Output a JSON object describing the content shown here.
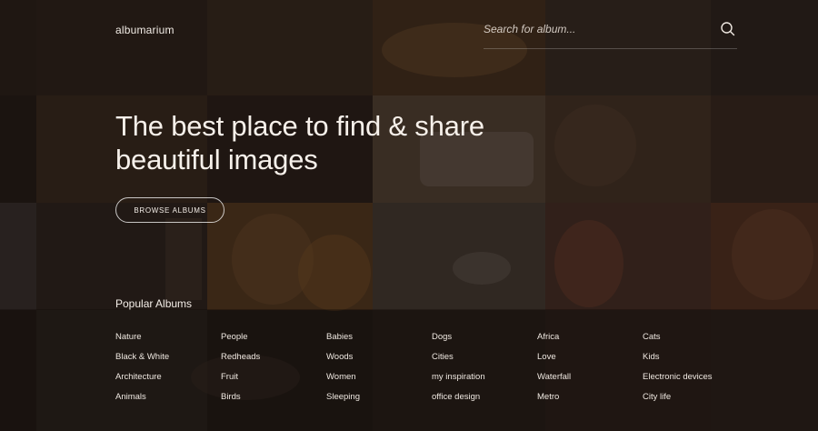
{
  "header": {
    "brand": "albumarium",
    "search_placeholder": "Search for album...",
    "search_icon": "search-icon"
  },
  "hero": {
    "title_line1": "The best place to find & share",
    "title_line2": "beautiful images",
    "browse_label": "BROWSE ALBUMS"
  },
  "popular": {
    "title": "Popular Albums",
    "columns": [
      [
        "Nature",
        "Black & White",
        "Architecture",
        "Animals"
      ],
      [
        "People",
        "Redheads",
        "Fruit",
        "Birds"
      ],
      [
        "Babies",
        "Woods",
        "Women",
        "Sleeping"
      ],
      [
        "Dogs",
        "Cities",
        "my inspiration",
        "office design"
      ],
      [
        "Africa",
        "Love",
        "Waterfall",
        "Metro"
      ],
      [
        "Cats",
        "Kids",
        "Electronic devices",
        "City life"
      ]
    ]
  },
  "colors": {
    "background": "#1e1612",
    "text": "#f3ece6"
  }
}
